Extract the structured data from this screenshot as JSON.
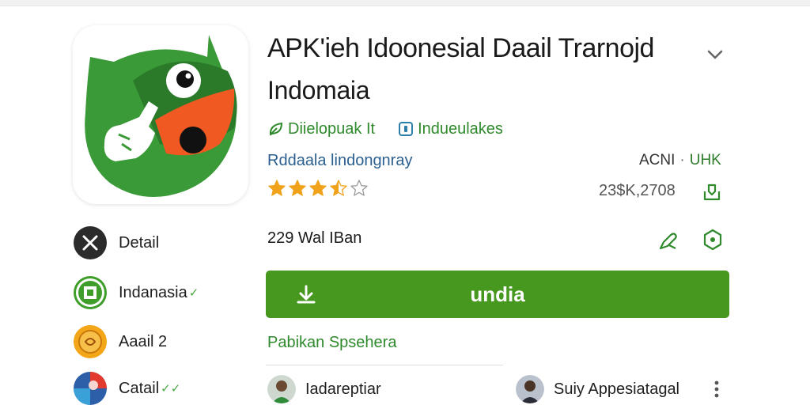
{
  "header": {
    "title": "APK'ieh Idoonesial Daail Trarnojd",
    "subtitle": "Indomaia"
  },
  "meta": {
    "item1": "Diielopuak It",
    "item2": "Indueulakes"
  },
  "developer": "Rddaala lindongnray",
  "tags": {
    "tag1": "ACNI",
    "separator": "·",
    "tag2": "UHK"
  },
  "rating": {
    "stars": 3.5,
    "max": 5,
    "count": "23$K,2708"
  },
  "downloads": "229 Wal IBan",
  "install_button": {
    "label": "undia"
  },
  "more_link": "Pabikan Spsehera",
  "side_items": [
    {
      "label": "Detail",
      "mark": ""
    },
    {
      "label": "Indanasia",
      "mark": "✓"
    },
    {
      "label": "Aaail 2",
      "mark": ""
    },
    {
      "label": "Catail",
      "mark": "✓✓"
    }
  ],
  "people": [
    {
      "name": "Iadareptiar"
    },
    {
      "name": "Suiy Appesiatagal"
    }
  ],
  "colors": {
    "brand_green": "#46981f",
    "link_green": "#2f8a2c",
    "star_gold": "#f0a21a",
    "developer_blue": "#2b5f8f"
  },
  "icons": {
    "chevron": "chevron-down-icon",
    "share": "share-icon",
    "wishlist": "wishlist-icon",
    "info": "info-icon",
    "download": "download-icon",
    "more": "more-vert-icon"
  }
}
